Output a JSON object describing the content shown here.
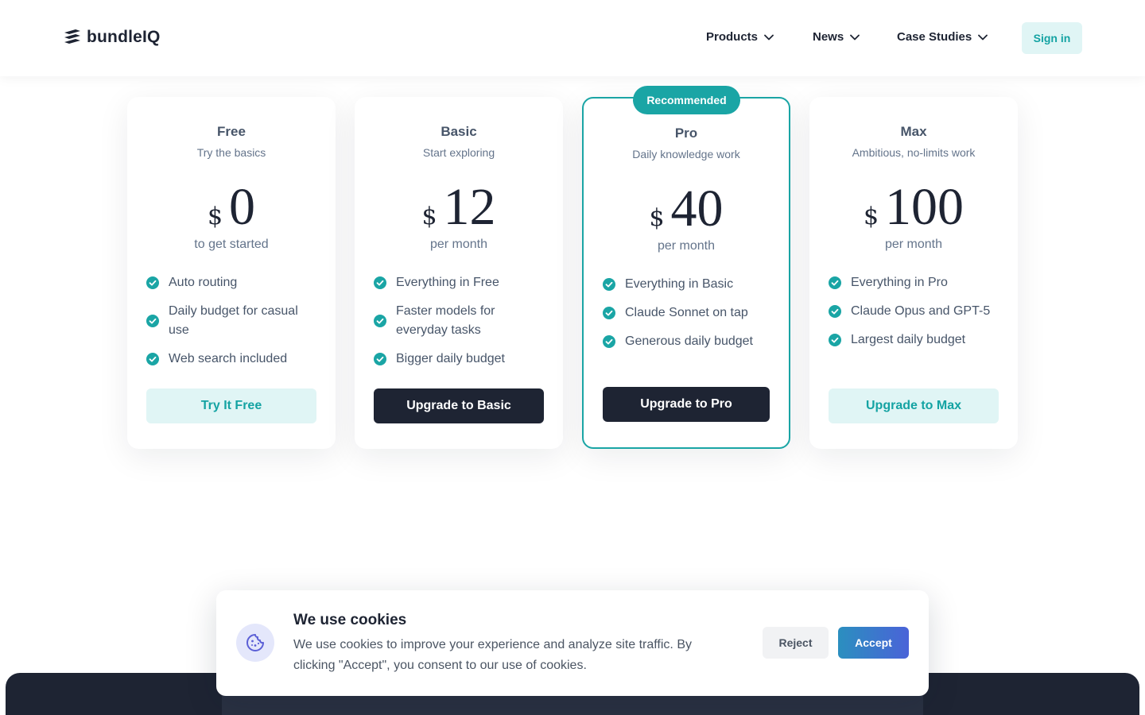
{
  "header": {
    "brand": "bundleIQ",
    "nav": [
      {
        "label": "Products"
      },
      {
        "label": "News"
      },
      {
        "label": "Case Studies"
      }
    ],
    "signin_label": "Sign in"
  },
  "plans": [
    {
      "name": "Free",
      "tagline": "Try the basics",
      "currency": "$",
      "price": "0",
      "period": "to get started",
      "features": [
        "Auto routing",
        "Daily budget for casual use",
        "Web search included"
      ],
      "cta": "Try It Free",
      "cta_style": "light"
    },
    {
      "name": "Basic",
      "tagline": "Start exploring",
      "currency": "$",
      "price": "12",
      "period": "per month",
      "features": [
        "Everything in Free",
        "Faster models for everyday tasks",
        "Bigger daily budget"
      ],
      "cta": "Upgrade to Basic",
      "cta_style": "dark"
    },
    {
      "name": "Pro",
      "badge": "Recommended",
      "tagline": "Daily knowledge work",
      "currency": "$",
      "price": "40",
      "period": "per month",
      "features": [
        "Everything in Basic",
        "Claude Sonnet on tap",
        "Generous daily budget"
      ],
      "cta": "Upgrade to Pro",
      "cta_style": "dark"
    },
    {
      "name": "Max",
      "tagline": "Ambitious, no-limits work",
      "currency": "$",
      "price": "100",
      "period": "per month",
      "features": [
        "Everything in Pro",
        "Claude Opus and GPT-5",
        "Largest daily budget"
      ],
      "cta": "Upgrade to Max",
      "cta_style": "light"
    }
  ],
  "cookie": {
    "title": "We use cookies",
    "text": "We use cookies to improve your experience and analyze site traffic. By clicking \"Accept\", you consent to our use of cookies.",
    "reject_label": "Reject",
    "accept_label": "Accept"
  },
  "colors": {
    "accent": "#1aa5a5",
    "dark": "#1e2433",
    "light_button_bg": "#e0f5f5"
  },
  "icons": {
    "logo": "bundle-stack-icon",
    "nav_dropdown": "chevron-down-icon",
    "feature": "check-circle-icon",
    "cookie": "cookie-icon"
  }
}
